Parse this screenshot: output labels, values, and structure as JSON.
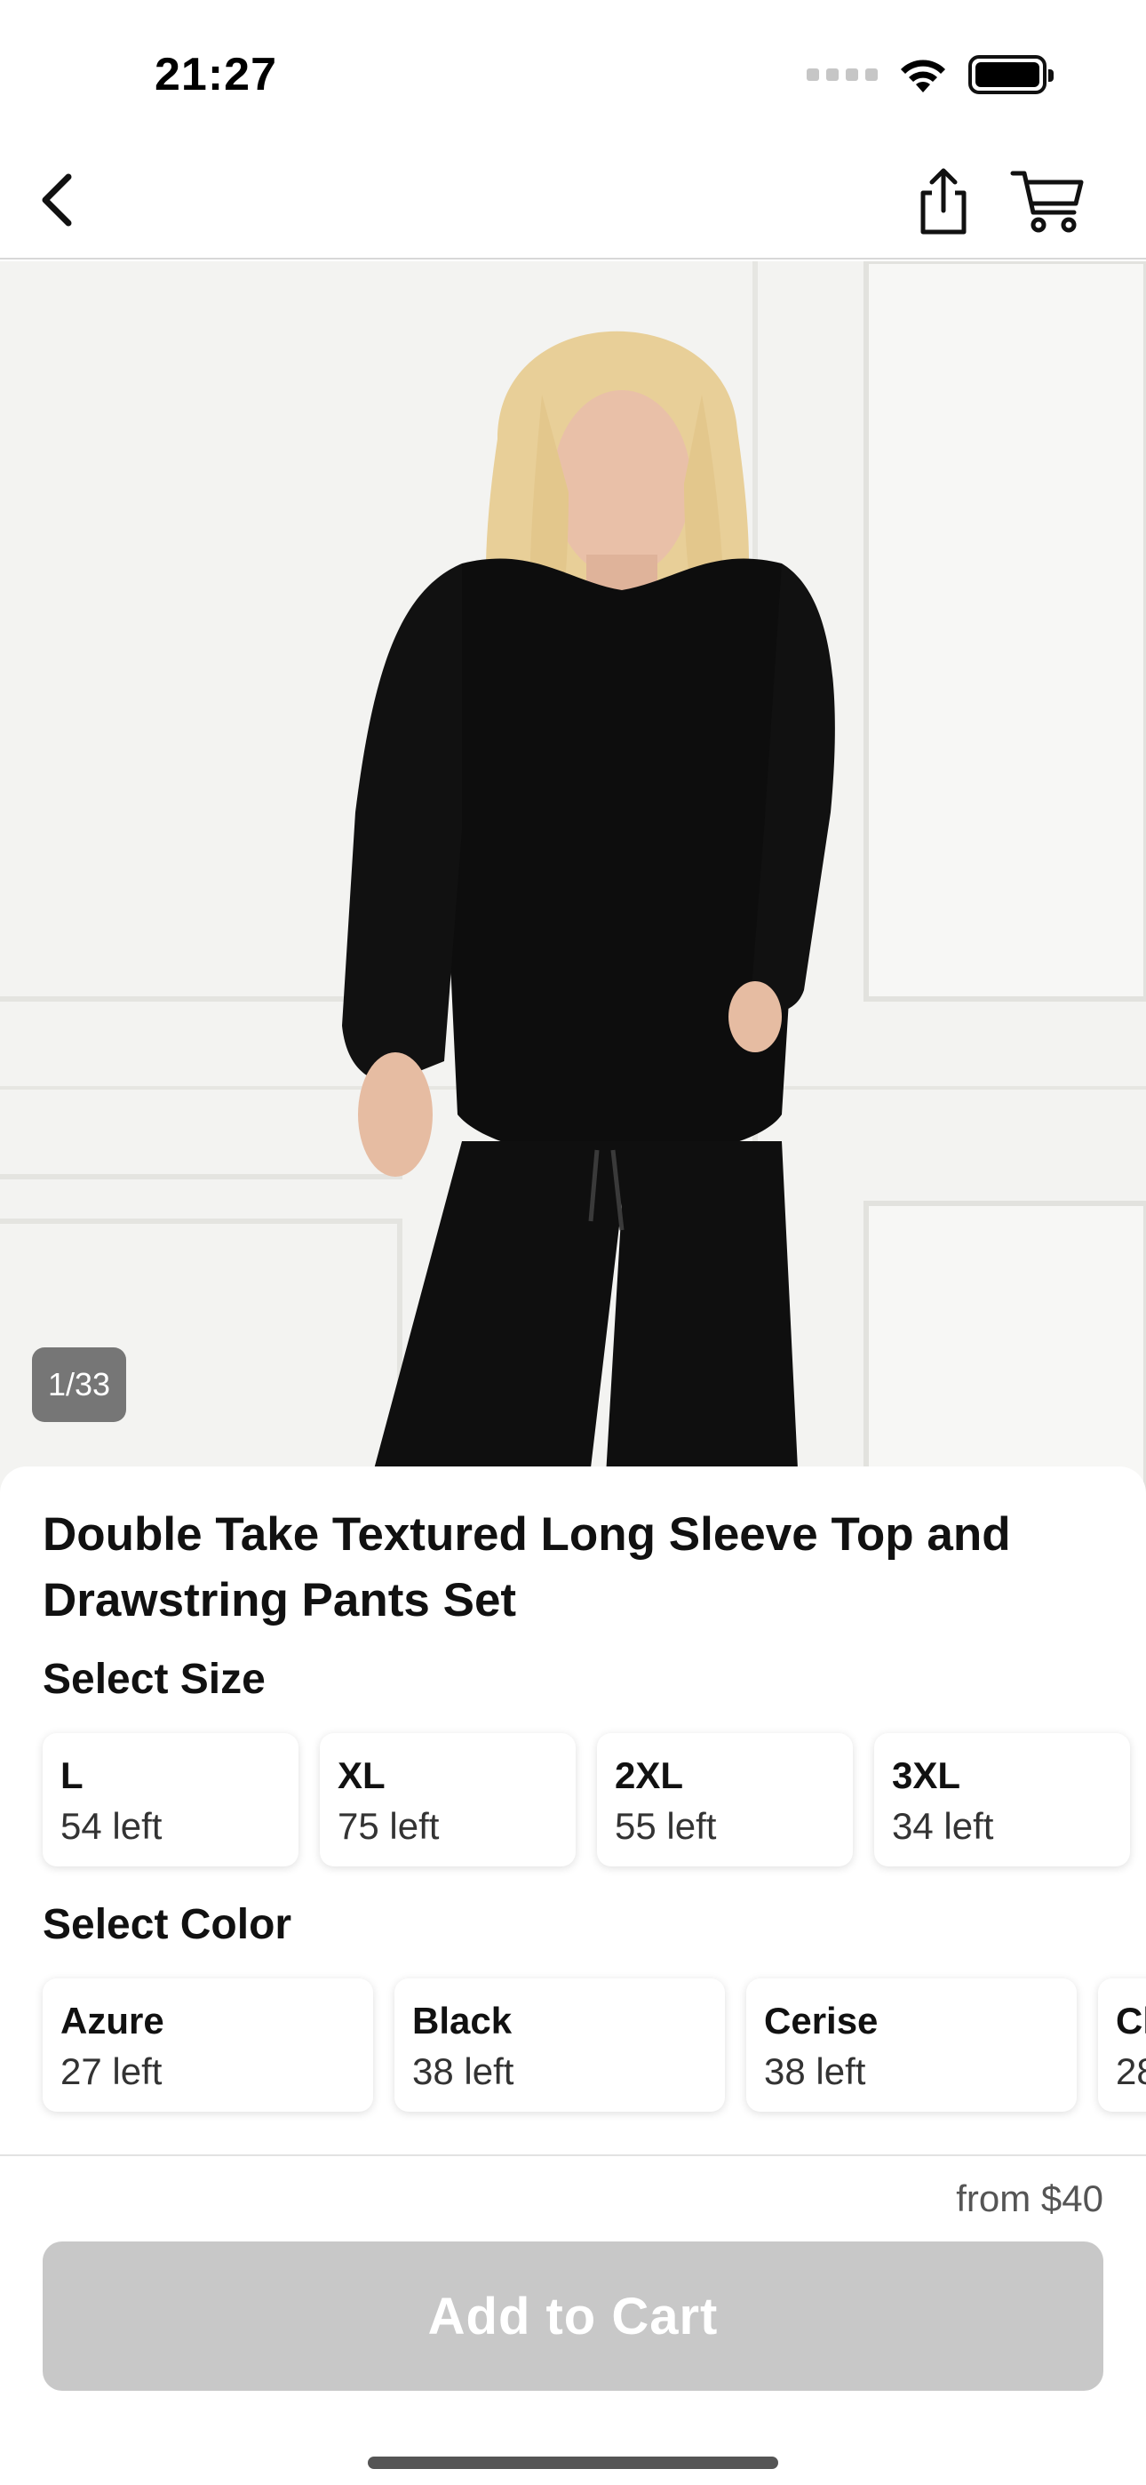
{
  "status_bar": {
    "time": "21:27",
    "icons": [
      "cellular-signal-icon",
      "wifi-icon",
      "battery-icon"
    ]
  },
  "nav": {
    "back_icon": "chevron-left-icon",
    "share_icon": "share-icon",
    "cart_icon": "cart-icon"
  },
  "gallery": {
    "counter": "1/33"
  },
  "product": {
    "title": "Double Take Textured Long Sleeve Top and Drawstring Pants Set"
  },
  "size_section": {
    "label": "Select Size",
    "options": [
      {
        "name": "L",
        "stock": "54 left"
      },
      {
        "name": "XL",
        "stock": "75 left"
      },
      {
        "name": "2XL",
        "stock": "55 left"
      },
      {
        "name": "3XL",
        "stock": "34 left"
      }
    ]
  },
  "color_section": {
    "label": "Select Color",
    "options": [
      {
        "name": "Azure",
        "stock": "27 left"
      },
      {
        "name": "Black",
        "stock": "38 left"
      },
      {
        "name": "Cerise",
        "stock": "38 left"
      },
      {
        "name": "Cl",
        "stock": "28"
      }
    ]
  },
  "footer": {
    "price": "from $40",
    "add_to_cart_label": "Add to Cart"
  },
  "colors": {
    "button_disabled": "#c8c8c8",
    "text": "#111111",
    "garment": "#0d0d0d"
  }
}
